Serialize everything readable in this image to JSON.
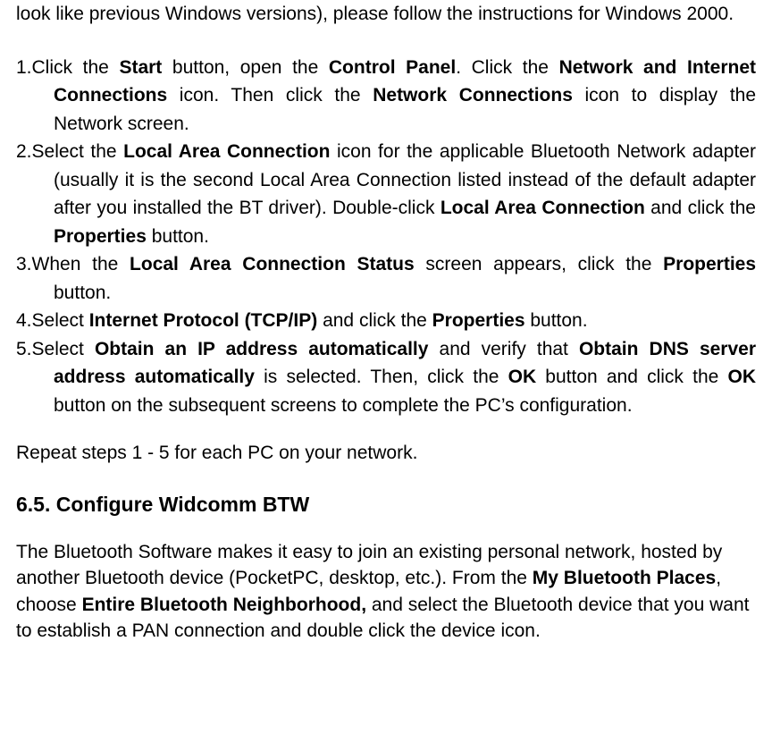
{
  "intro_pre": "look like previous Windows versions), please follow the instructions for Windows 2000.",
  "steps": [
    {
      "num": "1.",
      "parts": [
        {
          "t": "Click the "
        },
        {
          "b": "Start"
        },
        {
          "t": " button, open the "
        },
        {
          "b": "Control Panel"
        },
        {
          "t": ". Click the "
        },
        {
          "b": "Network and Internet Connections"
        },
        {
          "t": " icon. Then click the "
        },
        {
          "b": "Network Connections"
        },
        {
          "t": " icon to display the Network screen."
        }
      ]
    },
    {
      "num": "2.",
      "parts": [
        {
          "t": "Select the "
        },
        {
          "b": "Local Area Connection"
        },
        {
          "t": " icon for the applicable Bluetooth Network adapter (usually it is the second Local Area Connection listed instead of the default adapter after you installed the BT driver).  Double-click "
        },
        {
          "b": "Local Area Connection"
        },
        {
          "t": " and click the "
        },
        {
          "b": "Properties"
        },
        {
          "t": " button."
        }
      ]
    },
    {
      "num": "3.",
      "parts": [
        {
          "t": "When the "
        },
        {
          "b": "Local Area Connection Status"
        },
        {
          "t": " screen appears, click the "
        },
        {
          "b": "Properties"
        },
        {
          "t": " button."
        }
      ]
    },
    {
      "num": "4.",
      "parts": [
        {
          "t": "Select "
        },
        {
          "b": "Internet Protocol (TCP/IP)"
        },
        {
          "t": " and click the "
        },
        {
          "b": "Properties"
        },
        {
          "t": " button."
        }
      ]
    },
    {
      "num": "5.",
      "parts": [
        {
          "t": "Select "
        },
        {
          "b": "Obtain an IP address automatically"
        },
        {
          "t": " and verify that "
        },
        {
          "b": "Obtain DNS server address automatically"
        },
        {
          "t": " is selected.  Then, click the "
        },
        {
          "b": "OK"
        },
        {
          "t": " button and click the "
        },
        {
          "b": "OK"
        },
        {
          "t": " button on the subsequent screens to complete the PC’s configuration."
        }
      ]
    }
  ],
  "repeat": "Repeat steps 1 - 5 for each PC on your network.",
  "heading": " 6.5. Configure Widcomm BTW",
  "section_parts": [
    {
      "t": "The Bluetooth Software makes it easy to join an existing personal network, hosted by another Bluetooth device (PocketPC, desktop, etc.). From the "
    },
    {
      "b": "My Bluetooth Places"
    },
    {
      "t": ", choose "
    },
    {
      "b": "Entire Bluetooth Neighborhood,"
    },
    {
      "t": " and select the Bluetooth device that you want to establish a PAN connection and double click the device icon."
    }
  ]
}
